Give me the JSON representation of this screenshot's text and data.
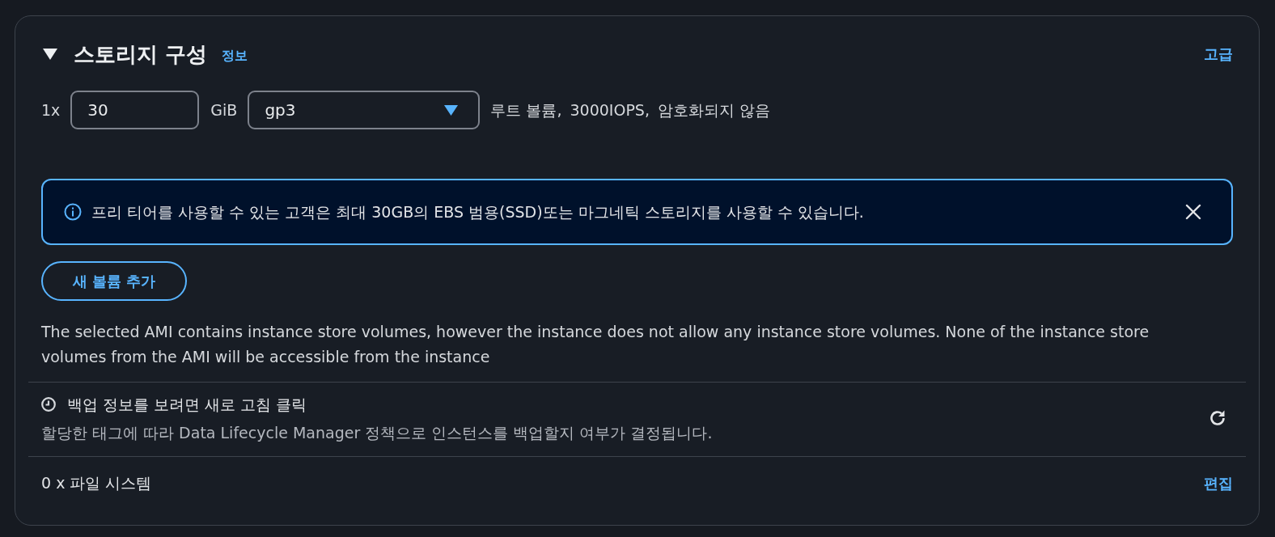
{
  "section": {
    "title": "스토리지 구성",
    "expanded": true,
    "info_link": "정보",
    "advanced_link": "고급"
  },
  "volume": {
    "count": "1x",
    "size": "30",
    "unit": "GiB",
    "type": "gp3",
    "details": [
      "루트 볼륨,",
      "3000IOPS,",
      "암호화되지 않음"
    ]
  },
  "alert": {
    "kind": "info",
    "message": "프리 티어를 사용할 수 있는 고객은 최대 30GB의 EBS 범용(SSD)또는 마그네틱 스토리지를 사용할 수 있습니다."
  },
  "add_volume_button": "새 볼륨 추가",
  "notice": "The selected AMI contains instance store volumes, however the instance does not allow any instance store volumes. None of the instance store volumes from the AMI will be accessible from the instance",
  "backup": {
    "title": "백업 정보를 보려면 새로 고침 클릭",
    "description": "할당한 태그에 따라 Data Lifecycle Manager 정책으로 인스턴스를 백업할지 여부가 결정됩니다."
  },
  "file_systems": {
    "label": "0 x 파일 시스템",
    "edit_link": "편집"
  }
}
